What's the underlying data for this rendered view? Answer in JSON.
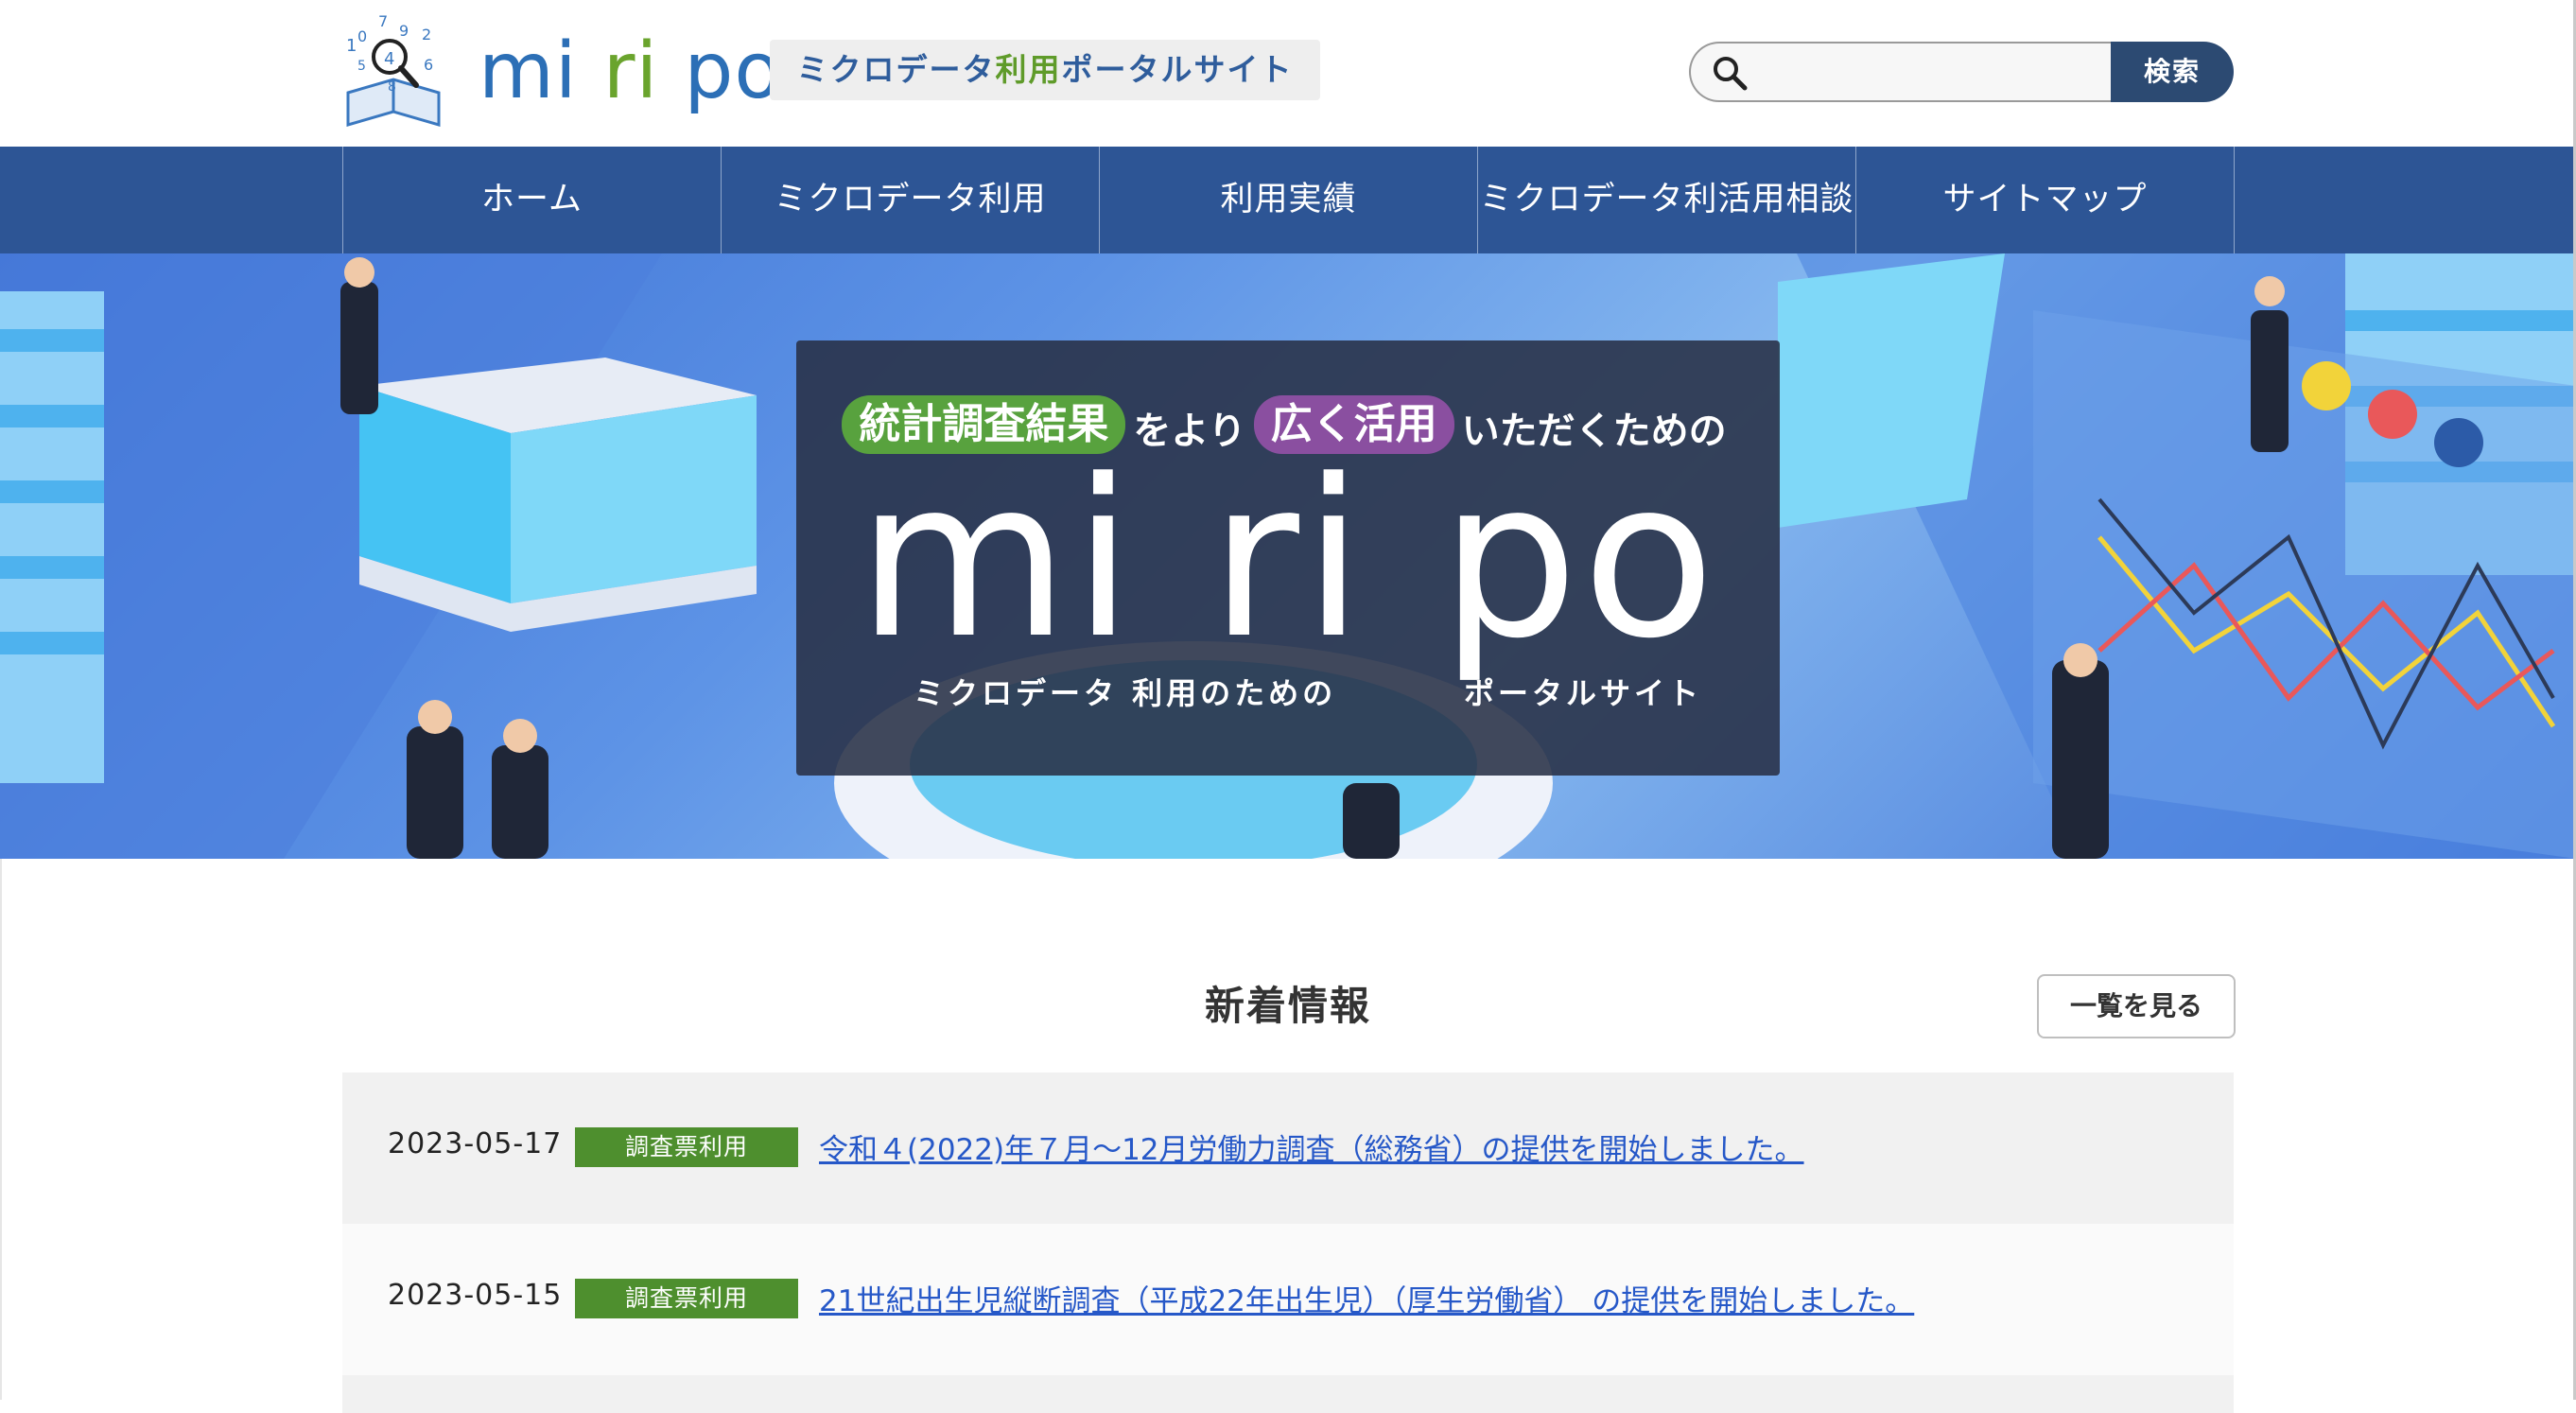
{
  "header": {
    "logo_text_mi": "mi",
    "logo_text_ri": "ri",
    "logo_text_po": "po",
    "tagline_a": "ミクロデータ",
    "tagline_b": "利用",
    "tagline_c": "ポータルサイト",
    "search_placeholder": "",
    "search_button": "検索"
  },
  "nav": {
    "items": [
      {
        "label": "ホーム"
      },
      {
        "label": "ミクロデータ利用"
      },
      {
        "label": "利用実績"
      },
      {
        "label": "ミクロデータ利活用相談"
      },
      {
        "label": "サイトマップ"
      }
    ]
  },
  "hero": {
    "pill1": "統計調査結果",
    "mid1": "をより",
    "pill2": "広く活用",
    "mid2": "いただくための",
    "title": "mi ri po",
    "caption_left": "ミクロデータ 利用のための",
    "caption_right": "ポータルサイト"
  },
  "news": {
    "title": "新着情報",
    "list_button": "一覧を見る",
    "items": [
      {
        "date": "2023-05-17",
        "badge": "調査票利用",
        "text": "令和４(2022)年７月〜12月労働力調査（総務省）の提供を開始しました。"
      },
      {
        "date": "2023-05-15",
        "badge": "調査票利用",
        "text": "21世紀出生児縦断調査（平成22年出生児）（厚生労働省） の提供を開始しました。"
      }
    ]
  },
  "colors": {
    "nav_bg": "#2d5595",
    "brand_blue": "#2c6fb6",
    "brand_green": "#6aa42d",
    "badge_green": "#4e8f2e",
    "link_blue": "#2658c8"
  }
}
